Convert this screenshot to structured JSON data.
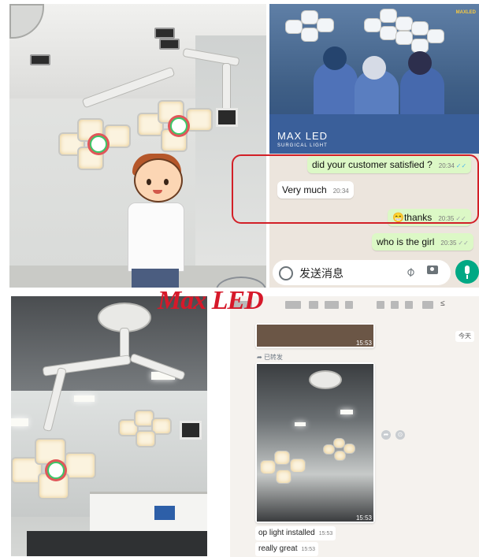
{
  "surgery_photo": {
    "brand": "MAX LED",
    "brand_sub": "SURGICAL LIGHT",
    "corner_logo": "MAXLED"
  },
  "chat_top": {
    "messages": [
      {
        "direction": "outgoing",
        "text": "did your customer satisfied ?",
        "time": "20:34",
        "status": "read"
      },
      {
        "direction": "incoming",
        "text": "Very much",
        "time": "20:34"
      },
      {
        "direction": "outgoing",
        "text": "thanks",
        "emoji": "😁",
        "time": "20:35",
        "status": "delivered"
      },
      {
        "direction": "outgoing",
        "text": "who is the girl",
        "time": "20:35",
        "status": "delivered"
      }
    ],
    "input_placeholder": "发送消息",
    "highlight_color": "#d21f27"
  },
  "watermark": "Max LED",
  "chat_bottom": {
    "header_tail": "≤",
    "today_label": "今天",
    "forwarded_label": "已转发",
    "image_messages": [
      {
        "time": "15:53"
      },
      {
        "time": "15:53"
      }
    ],
    "text_messages": [
      {
        "text": "op light installed",
        "time": "15:53"
      },
      {
        "text": "really great",
        "time": "15:53"
      }
    ]
  },
  "colors": {
    "outgoing_bubble": "#dcf8c6",
    "incoming_bubble": "#ffffff",
    "send_button": "#00a884",
    "read_tick": "#4fb6ec"
  }
}
